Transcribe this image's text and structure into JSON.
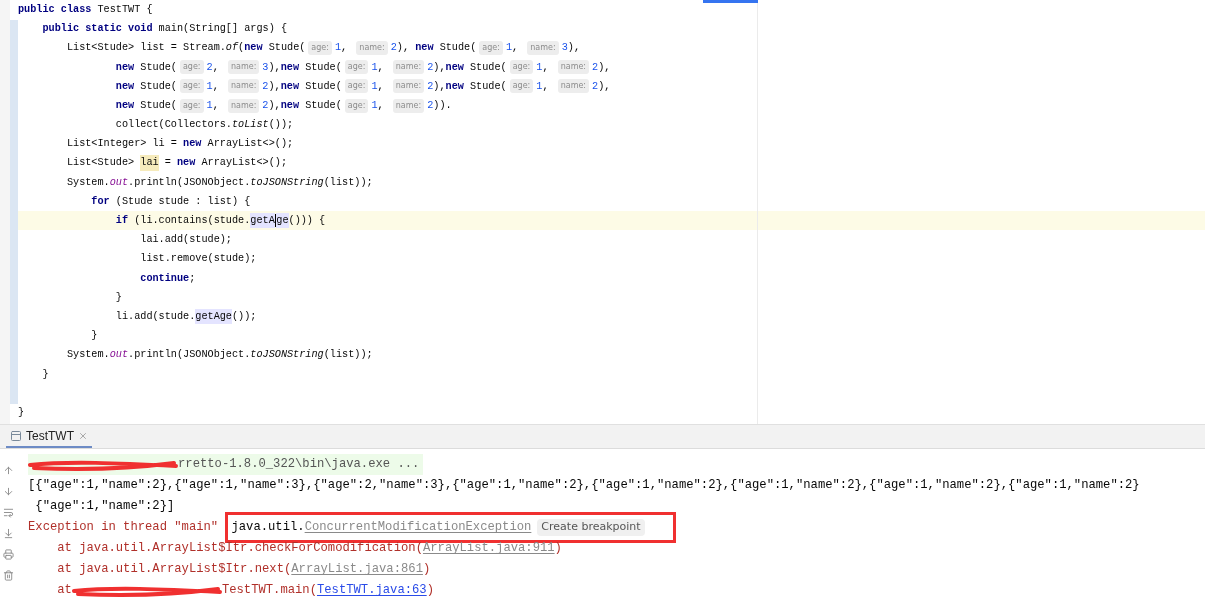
{
  "editor": {
    "lines": [
      {
        "current": false,
        "tokens": [
          {
            "kind": "kw",
            "text": "public class"
          },
          {
            "kind": "text",
            "text": " TestTWT {"
          }
        ]
      },
      {
        "current": false,
        "tokens": [
          {
            "kind": "kw",
            "text": "    public static void"
          },
          {
            "kind": "text",
            "text": " main(String[] args) {"
          }
        ]
      },
      {
        "current": false,
        "tokens": [
          {
            "kind": "text",
            "text": "        List<Stude> list = Stream."
          },
          {
            "kind": "italic",
            "text": "of"
          },
          {
            "kind": "text",
            "text": "("
          },
          {
            "kind": "kw",
            "text": "new"
          },
          {
            "kind": "text",
            "text": " Stude("
          },
          {
            "kind": "hint",
            "text": "age:"
          },
          {
            "kind": "num",
            "text": "1"
          },
          {
            "kind": "text",
            "text": ", "
          },
          {
            "kind": "hint",
            "text": "name:"
          },
          {
            "kind": "num",
            "text": "2"
          },
          {
            "kind": "text",
            "text": "), "
          },
          {
            "kind": "kw",
            "text": "new"
          },
          {
            "kind": "text",
            "text": " Stude("
          },
          {
            "kind": "hint",
            "text": "age:"
          },
          {
            "kind": "num",
            "text": "1"
          },
          {
            "kind": "text",
            "text": ", "
          },
          {
            "kind": "hint",
            "text": "name:"
          },
          {
            "kind": "num",
            "text": "3"
          },
          {
            "kind": "text",
            "text": "),"
          }
        ]
      },
      {
        "current": false,
        "tokens": [
          {
            "kind": "kw",
            "text": "                new"
          },
          {
            "kind": "text",
            "text": " Stude("
          },
          {
            "kind": "hint",
            "text": "age:"
          },
          {
            "kind": "num",
            "text": "2"
          },
          {
            "kind": "text",
            "text": ", "
          },
          {
            "kind": "hint",
            "text": "name:"
          },
          {
            "kind": "num",
            "text": "3"
          },
          {
            "kind": "text",
            "text": "),"
          },
          {
            "kind": "kw",
            "text": "new"
          },
          {
            "kind": "text",
            "text": " Stude("
          },
          {
            "kind": "hint",
            "text": "age:"
          },
          {
            "kind": "num",
            "text": "1"
          },
          {
            "kind": "text",
            "text": ", "
          },
          {
            "kind": "hint",
            "text": "name:"
          },
          {
            "kind": "num",
            "text": "2"
          },
          {
            "kind": "text",
            "text": "),"
          },
          {
            "kind": "kw",
            "text": "new"
          },
          {
            "kind": "text",
            "text": " Stude("
          },
          {
            "kind": "hint",
            "text": "age:"
          },
          {
            "kind": "num",
            "text": "1"
          },
          {
            "kind": "text",
            "text": ", "
          },
          {
            "kind": "hint",
            "text": "name:"
          },
          {
            "kind": "num",
            "text": "2"
          },
          {
            "kind": "text",
            "text": "),"
          }
        ]
      },
      {
        "current": false,
        "tokens": [
          {
            "kind": "kw",
            "text": "                new"
          },
          {
            "kind": "text",
            "text": " Stude("
          },
          {
            "kind": "hint",
            "text": "age:"
          },
          {
            "kind": "num",
            "text": "1"
          },
          {
            "kind": "text",
            "text": ", "
          },
          {
            "kind": "hint",
            "text": "name:"
          },
          {
            "kind": "num",
            "text": "2"
          },
          {
            "kind": "text",
            "text": "),"
          },
          {
            "kind": "kw",
            "text": "new"
          },
          {
            "kind": "text",
            "text": " Stude("
          },
          {
            "kind": "hint",
            "text": "age:"
          },
          {
            "kind": "num",
            "text": "1"
          },
          {
            "kind": "text",
            "text": ", "
          },
          {
            "kind": "hint",
            "text": "name:"
          },
          {
            "kind": "num",
            "text": "2"
          },
          {
            "kind": "text",
            "text": "),"
          },
          {
            "kind": "kw",
            "text": "new"
          },
          {
            "kind": "text",
            "text": " Stude("
          },
          {
            "kind": "hint",
            "text": "age:"
          },
          {
            "kind": "num",
            "text": "1"
          },
          {
            "kind": "text",
            "text": ", "
          },
          {
            "kind": "hint",
            "text": "name:"
          },
          {
            "kind": "num",
            "text": "2"
          },
          {
            "kind": "text",
            "text": "),"
          }
        ]
      },
      {
        "current": false,
        "tokens": [
          {
            "kind": "kw",
            "text": "                new"
          },
          {
            "kind": "text",
            "text": " Stude("
          },
          {
            "kind": "hint",
            "text": "age:"
          },
          {
            "kind": "num",
            "text": "1"
          },
          {
            "kind": "text",
            "text": ", "
          },
          {
            "kind": "hint",
            "text": "name:"
          },
          {
            "kind": "num",
            "text": "2"
          },
          {
            "kind": "text",
            "text": "),"
          },
          {
            "kind": "kw",
            "text": "new"
          },
          {
            "kind": "text",
            "text": " Stude("
          },
          {
            "kind": "hint",
            "text": "age:"
          },
          {
            "kind": "num",
            "text": "1"
          },
          {
            "kind": "text",
            "text": ", "
          },
          {
            "kind": "hint",
            "text": "name:"
          },
          {
            "kind": "num",
            "text": "2"
          },
          {
            "kind": "text",
            "text": "))."
          }
        ]
      },
      {
        "current": false,
        "tokens": [
          {
            "kind": "text",
            "text": "                collect(Collectors."
          },
          {
            "kind": "italic",
            "text": "toList"
          },
          {
            "kind": "text",
            "text": "());"
          }
        ]
      },
      {
        "current": false,
        "tokens": [
          {
            "kind": "text",
            "text": "        List<Integer> li = "
          },
          {
            "kind": "kw",
            "text": "new"
          },
          {
            "kind": "text",
            "text": " ArrayList<>();"
          }
        ]
      },
      {
        "current": false,
        "tokens": [
          {
            "kind": "text",
            "text": "        List<Stude> "
          },
          {
            "kind": "write",
            "text": "lai"
          },
          {
            "kind": "text",
            "text": " = "
          },
          {
            "kind": "kw",
            "text": "new"
          },
          {
            "kind": "text",
            "text": " ArrayList<>();"
          }
        ]
      },
      {
        "current": false,
        "tokens": [
          {
            "kind": "text",
            "text": "        System."
          },
          {
            "kind": "static",
            "text": "out"
          },
          {
            "kind": "text",
            "text": ".println(JSONObject."
          },
          {
            "kind": "italic",
            "text": "toJSONString"
          },
          {
            "kind": "text",
            "text": "(list));"
          }
        ]
      },
      {
        "current": false,
        "tokens": [
          {
            "kind": "kw",
            "text": "            for"
          },
          {
            "kind": "text",
            "text": " (Stude stude : list) {"
          }
        ]
      },
      {
        "current": true,
        "tokens": [
          {
            "kind": "kw",
            "text": "                if"
          },
          {
            "kind": "text",
            "text": " (li.contains(stude."
          },
          {
            "kind": "usage",
            "text": "getA",
            "caret_before": false
          },
          {
            "kind": "usage",
            "text": "ge",
            "caret_before": true
          },
          {
            "kind": "text",
            "text": "())) {"
          }
        ]
      },
      {
        "current": false,
        "tokens": [
          {
            "kind": "text",
            "text": "                    lai.add(stude);"
          }
        ]
      },
      {
        "current": false,
        "tokens": [
          {
            "kind": "text",
            "text": "                    list.remove(stude);"
          }
        ]
      },
      {
        "current": false,
        "tokens": [
          {
            "kind": "kw",
            "text": "                    continue"
          },
          {
            "kind": "text",
            "text": ";"
          }
        ]
      },
      {
        "current": false,
        "tokens": [
          {
            "kind": "text",
            "text": "                }"
          }
        ]
      },
      {
        "current": false,
        "tokens": [
          {
            "kind": "text",
            "text": "                li.add(stude."
          },
          {
            "kind": "usage",
            "text": "getAge",
            "caret_before": false
          },
          {
            "kind": "text",
            "text": "());"
          }
        ]
      },
      {
        "current": false,
        "tokens": [
          {
            "kind": "text",
            "text": "            }"
          }
        ]
      },
      {
        "current": false,
        "tokens": [
          {
            "kind": "text",
            "text": "        System."
          },
          {
            "kind": "static",
            "text": "out"
          },
          {
            "kind": "text",
            "text": ".println(JSONObject."
          },
          {
            "kind": "italic",
            "text": "toJSONString"
          },
          {
            "kind": "text",
            "text": "(list));"
          }
        ]
      },
      {
        "current": false,
        "tokens": [
          {
            "kind": "text",
            "text": "    }"
          }
        ]
      },
      {
        "current": false
      },
      {
        "current": false,
        "tokens": [
          {
            "kind": "text",
            "text": "}"
          }
        ]
      }
    ]
  },
  "run_panel": {
    "tabs": [
      {
        "label": "TestTWT",
        "selected": true
      }
    ],
    "console": [
      {
        "kind": "command",
        "segments": [
          {
            "kind": "scribble"
          },
          {
            "kind": "dim",
            "text": "rretto-1.8.0_322\\bin\\java.exe ..."
          }
        ]
      },
      {
        "kind": "output",
        "segments": [
          {
            "kind": "out",
            "text": "[{\"age\":1,\"name\":2},{\"age\":1,\"name\":3},{\"age\":2,\"name\":3},{\"age\":1,\"name\":2},{\"age\":1,\"name\":2},{\"age\":1,\"name\":2},{\"age\":1,\"name\":2},{\"age\":1,\"name\":2}"
          }
        ]
      },
      {
        "kind": "output",
        "segments": [
          {
            "kind": "out",
            "text": " {\"age\":1,\"name\":2}]"
          }
        ]
      },
      {
        "kind": "output",
        "segments": [
          {
            "kind": "err",
            "text": "Exception in thread \"main\" "
          },
          {
            "kind": "out",
            "text": "java.util.",
            "annotated": true
          },
          {
            "kind": "link",
            "text": "ConcurrentModificationException",
            "annotated": true
          },
          {
            "kind": "chip",
            "text": "Create breakpoint",
            "annotated": true
          }
        ]
      },
      {
        "kind": "output",
        "segments": [
          {
            "kind": "err",
            "text": "    at java.util.ArrayList$Itr.checkForComodification("
          },
          {
            "kind": "link",
            "text": "ArrayList.java:911"
          },
          {
            "kind": "err",
            "text": ")"
          }
        ]
      },
      {
        "kind": "output",
        "segments": [
          {
            "kind": "err",
            "text": "    at java.util.ArrayList$Itr.next("
          },
          {
            "kind": "link",
            "text": "ArrayList.java:861"
          },
          {
            "kind": "err",
            "text": ")"
          }
        ]
      },
      {
        "kind": "output",
        "segments": [
          {
            "kind": "err",
            "text": "    at"
          },
          {
            "kind": "scribble"
          },
          {
            "kind": "err",
            "text": "TestTWT.main("
          },
          {
            "kind": "source",
            "text": "TestTWT.java:63"
          },
          {
            "kind": "err",
            "text": ")"
          }
        ]
      }
    ]
  }
}
